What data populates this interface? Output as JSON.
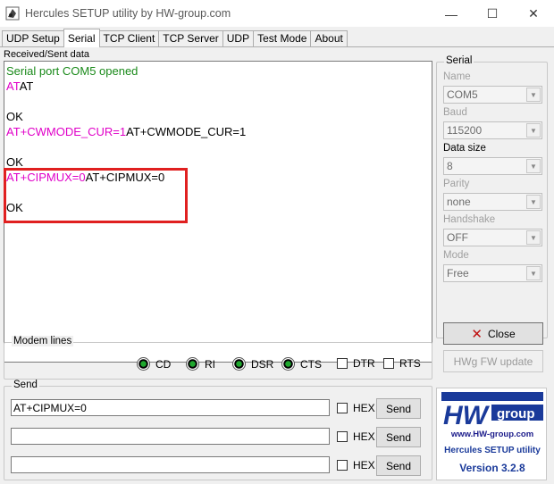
{
  "window": {
    "title": "Hercules SETUP utility by HW-group.com",
    "minimize_glyph": "—",
    "maximize_glyph": "☐",
    "close_glyph": "✕"
  },
  "tabs": [
    {
      "label": "UDP Setup",
      "active": false
    },
    {
      "label": "Serial",
      "active": true
    },
    {
      "label": "TCP Client",
      "active": false
    },
    {
      "label": "TCP Server",
      "active": false
    },
    {
      "label": "UDP",
      "active": false
    },
    {
      "label": "Test Mode",
      "active": false
    },
    {
      "label": "About",
      "active": false
    }
  ],
  "received": {
    "label": "Received/Sent data",
    "lines": [
      [
        {
          "text": "Serial port COM5 opened",
          "color": "green"
        }
      ],
      [
        {
          "text": "AT",
          "color": "pink"
        },
        {
          "text": "AT",
          "color": "black"
        }
      ],
      [
        {
          "text": "",
          "color": "black"
        }
      ],
      [
        {
          "text": "OK",
          "color": "black"
        }
      ],
      [
        {
          "text": "AT+CWMODE_CUR=1",
          "color": "pink"
        },
        {
          "text": "AT+CWMODE_CUR=1",
          "color": "black"
        }
      ],
      [
        {
          "text": "",
          "color": "black"
        }
      ],
      [
        {
          "text": "OK",
          "color": "black"
        }
      ],
      [
        {
          "text": "AT+CIPMUX=0",
          "color": "pink"
        },
        {
          "text": "AT+CIPMUX=0",
          "color": "black"
        }
      ],
      [
        {
          "text": "",
          "color": "black"
        }
      ],
      [
        {
          "text": "OK",
          "color": "black"
        }
      ]
    ]
  },
  "modem": {
    "title": "Modem lines",
    "leds": [
      "CD",
      "RI",
      "DSR",
      "CTS"
    ],
    "checks": [
      "DTR",
      "RTS"
    ]
  },
  "send": {
    "title": "Send",
    "rows": [
      {
        "value": "AT+CIPMUX=0",
        "hex_label": "HEX",
        "button": "Send"
      },
      {
        "value": "",
        "hex_label": "HEX",
        "button": "Send"
      },
      {
        "value": "",
        "hex_label": "HEX",
        "button": "Send"
      }
    ]
  },
  "serial": {
    "title": "Serial",
    "fields": [
      {
        "label": "Name",
        "value": "COM5",
        "enabled": false
      },
      {
        "label": "Baud",
        "value": "115200",
        "enabled": false
      },
      {
        "label": "Data size",
        "value": "8",
        "enabled": true
      },
      {
        "label": "Parity",
        "value": "none",
        "enabled": false
      },
      {
        "label": "Handshake",
        "value": "OFF",
        "enabled": false
      },
      {
        "label": "Mode",
        "value": "Free",
        "enabled": false
      }
    ],
    "close_button": "Close",
    "fw_button": "HWg FW update"
  },
  "logo": {
    "url": "www.HW-group.com",
    "app": "Hercules SETUP utility",
    "version": "Version  3.2.8",
    "wordmark_hw": "HW",
    "wordmark_group": "group"
  },
  "colors": {
    "green_text": "#1a8a1a",
    "pink_text": "#e000c8",
    "highlight": "#e02020",
    "logo_blue": "#1a3a9a"
  }
}
